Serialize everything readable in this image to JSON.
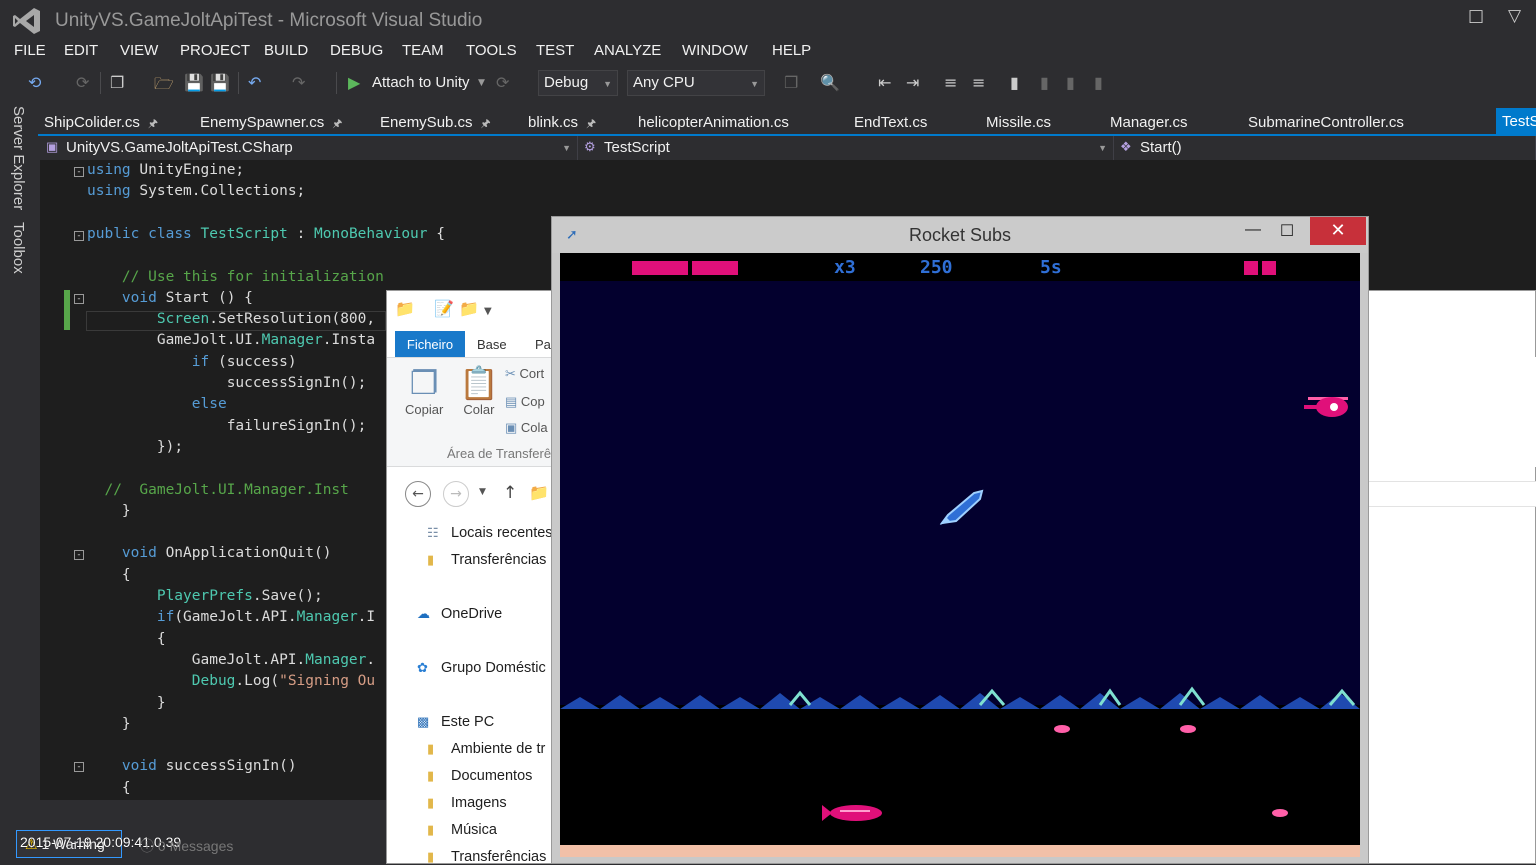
{
  "window": {
    "title": "UnityVS.GameJoltApiTest - Microsoft Visual Studio"
  },
  "menu": [
    "FILE",
    "EDIT",
    "VIEW",
    "PROJECT",
    "BUILD",
    "DEBUG",
    "TEAM",
    "TOOLS",
    "TEST",
    "ANALYZE",
    "WINDOW",
    "HELP"
  ],
  "toolbar": {
    "attach_label": "Attach to Unity",
    "config": "Debug",
    "platform": "Any CPU"
  },
  "side_tabs": [
    "Server Explorer",
    "Toolbox"
  ],
  "doc_tabs": [
    "ShipColider.cs",
    "EnemySpawner.cs",
    "EnemySub.cs",
    "blink.cs",
    "helicopterAnimation.cs",
    "EndText.cs",
    "Missile.cs",
    "Manager.cs",
    "SubmarineController.cs"
  ],
  "active_tab": "TestScript.cs",
  "navbar": {
    "project": "UnityVS.GameJoltApiTest.CSharp",
    "type": "TestScript",
    "member": "Start()"
  },
  "code": [
    "using UnityEngine;",
    "using System.Collections;",
    "",
    "public class TestScript : MonoBehaviour {",
    "",
    "    // Use this for initialization",
    "    void Start () {",
    "        Screen.SetResolution(800,",
    "        GameJolt.UI.Manager.Insta",
    "            if (success)",
    "                successSignIn();",
    "            else",
    "                failureSignIn();",
    "        });",
    "",
    "  //  GameJolt.UI.Manager.Inst",
    "    }",
    "",
    "    void OnApplicationQuit()",
    "    {",
    "        PlayerPrefs.Save();",
    "        if(GameJolt.API.Manager.I",
    "        {",
    "            GameJolt.API.Manager.",
    "            Debug.Log(\"Signing Ou",
    "        }",
    "    }",
    "",
    "    void successSignIn()",
    "    {"
  ],
  "status": {
    "warning": "1 Warning",
    "timestamp": "2015-07-19 20:09:41.0.39",
    "messages": "0 Messages"
  },
  "explorer": {
    "ribbon_tabs": [
      "Ficheiro",
      "Base",
      "Par"
    ],
    "clipboard": {
      "copy": "Copiar",
      "paste": "Colar",
      "cut": "Cort",
      "copy_path": "Cop",
      "paste_shortcut": "Cola",
      "group": "Área de Transferê"
    },
    "nav_items": [
      "Locais recentes",
      "Transferências",
      "OneDrive",
      "Grupo Doméstic",
      "Este PC",
      "Ambiente de tr",
      "Documentos",
      "Imagens",
      "Música",
      "Transferências"
    ]
  },
  "game": {
    "title": "Rocket Subs",
    "lives": "x3",
    "score": "250",
    "time": "5s",
    "colors": {
      "hud_pink": "#e0107a",
      "hud_blue": "#2f6fd6",
      "sky": "#03002e",
      "sand": "#f2c0a8"
    }
  }
}
